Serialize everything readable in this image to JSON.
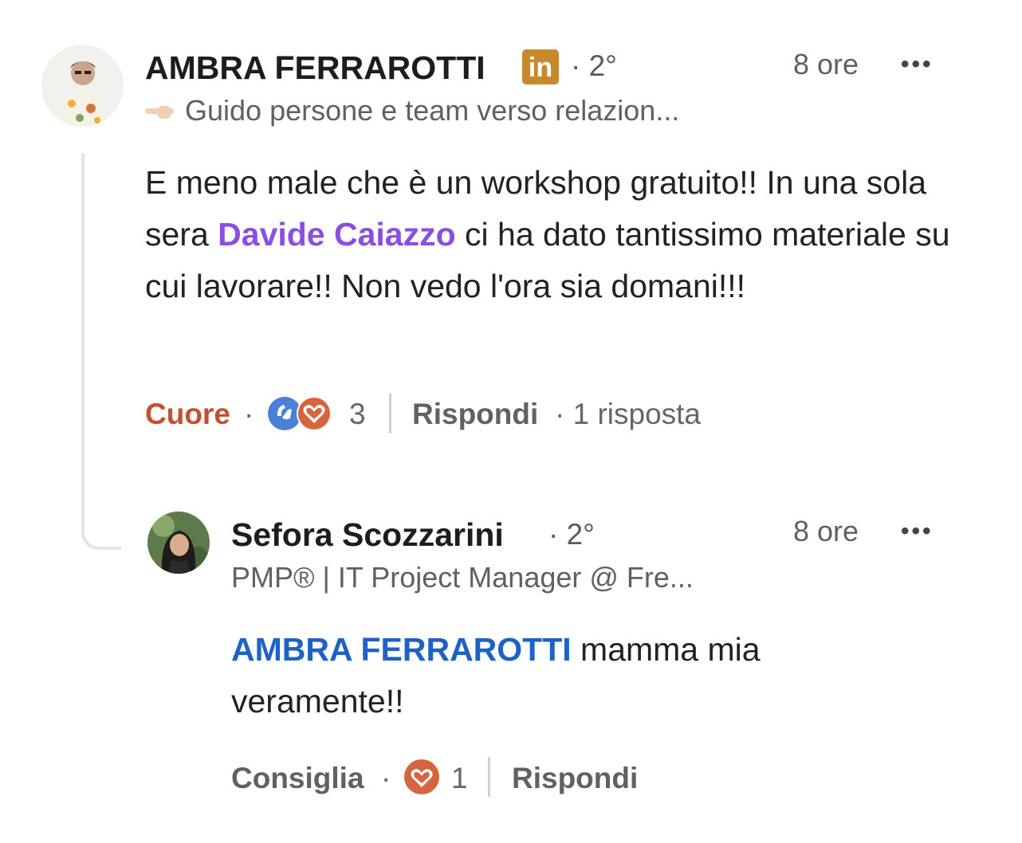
{
  "comment": {
    "author": "AMBRA FERRAROTTI",
    "linkedin_badge": "in",
    "degree": "· 2°",
    "headline": "Guido persone e team verso relazion...",
    "headline_icon": "pointing-hand-emoji",
    "time": "8 ore",
    "more_label": "•••",
    "text_before": "E meno male che è un workshop gratuito!! In una sola sera ",
    "mention": "Davide Caiazzo",
    "text_after": " ci ha dato tantissimo materiale su cui lavorare!! Non vedo l'ora sia domani!!!",
    "reaction_label": "Cuore",
    "sep": "·",
    "reaction_icons": [
      "clap-icon",
      "heart-icon"
    ],
    "reaction_count": "3",
    "reply_label": "Rispondi",
    "replies_count": "· 1 risposta",
    "colors": {
      "mention": "#8a4fe0",
      "reaction_active": "#c5502f",
      "badge": "#c8892c"
    }
  },
  "reply": {
    "author": "Sefora Scozzarini",
    "degree": "· 2°",
    "headline": "PMP® | IT Project Manager @ Fre...",
    "time": "8 ore",
    "more_label": "•••",
    "mention": "AMBRA FERRAROTTI",
    "text_after": " mamma mia veramente!!",
    "like_label": "Consiglia",
    "sep": "·",
    "reaction_icons": [
      "heart-icon"
    ],
    "reaction_count": "1",
    "reply_label": "Rispondi",
    "colors": {
      "mention": "#1f62c6"
    }
  }
}
